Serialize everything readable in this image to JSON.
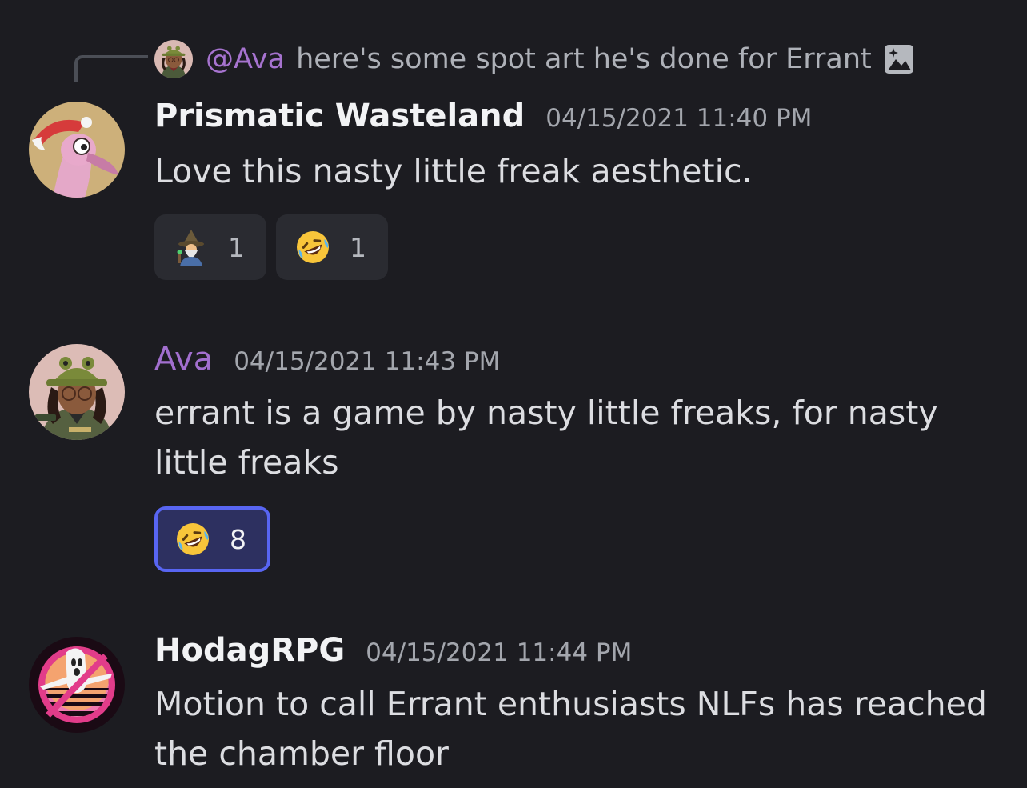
{
  "reply": {
    "mention": "@Ava",
    "text": "here's some spot art he's done for Errant",
    "attachment_icon": "image-icon"
  },
  "messages": [
    {
      "username": "Prismatic Wasteland",
      "timestamp": "04/15/2021 11:40 PM",
      "text": "Love this nasty little freak aesthetic.",
      "avatar": "pink-bird-santa-hat-avatar",
      "reactions": [
        {
          "emoji": "mage-emoji",
          "count": "1"
        },
        {
          "emoji": "rolling-laughing-emoji",
          "count": "1"
        }
      ]
    },
    {
      "username": "Ava",
      "timestamp": "04/15/2021 11:43 PM",
      "text": "errant is a game by nasty little freaks, for nasty little freaks",
      "avatar": "frog-hat-person-avatar",
      "reactions": [
        {
          "emoji": "rolling-laughing-emoji",
          "count": "8",
          "selected": true
        }
      ]
    },
    {
      "username": "HodagRPG",
      "timestamp": "04/15/2021 11:44 PM",
      "text": "Motion to call Errant enthusiasts NLFs has reached the chamber floor",
      "avatar": "ghost-sunset-avatar"
    }
  ],
  "colors": {
    "background": "#1c1c21",
    "username_purple": "#a26fcf",
    "mention_purple": "#a673cf",
    "reaction_bg": "#2a2b31",
    "reaction_selected_bg": "#2d3060",
    "reaction_selected_border": "#5865f2"
  }
}
